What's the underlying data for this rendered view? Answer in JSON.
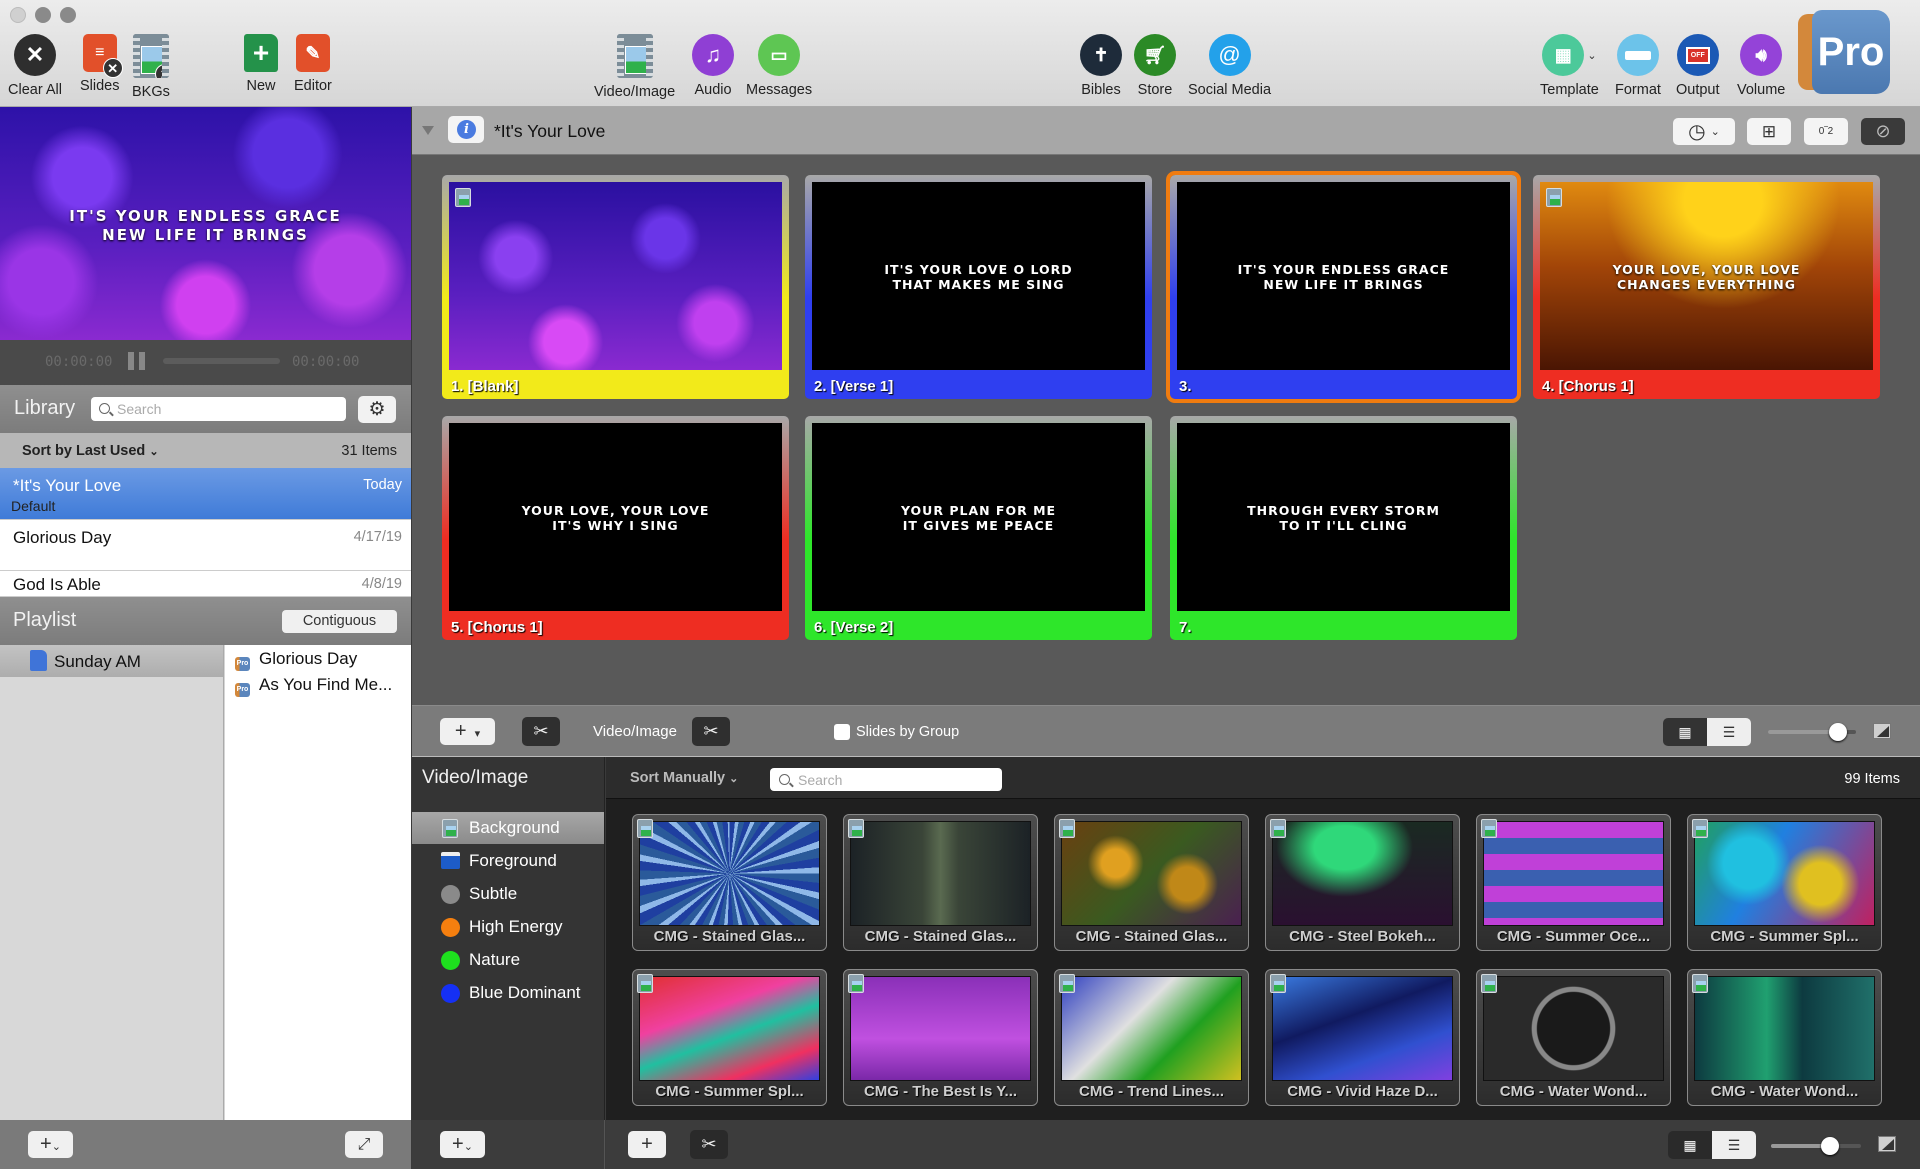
{
  "window": {
    "traffic_lights": [
      "close",
      "minimize",
      "zoom"
    ]
  },
  "toolbar": {
    "left": [
      {
        "label": "Clear All",
        "icon": "clear-all-icon"
      },
      {
        "label": "Slides",
        "icon": "clear-slides-icon"
      },
      {
        "label": "BKGs",
        "icon": "clear-backgrounds-icon"
      },
      {
        "label": "New",
        "icon": "new-document-icon"
      },
      {
        "label": "Editor",
        "icon": "editor-icon"
      }
    ],
    "center": [
      {
        "label": "Video/Image",
        "icon": "video-image-icon"
      },
      {
        "label": "Audio",
        "icon": "audio-icon"
      },
      {
        "label": "Messages",
        "icon": "messages-icon"
      }
    ],
    "center_right": [
      {
        "label": "Bibles",
        "icon": "bible-icon"
      },
      {
        "label": "Store",
        "icon": "store-cart-icon"
      },
      {
        "label": "Social Media",
        "icon": "at-sign-icon"
      }
    ],
    "right": [
      {
        "label": "Template",
        "icon": "template-icon"
      },
      {
        "label": "Format",
        "icon": "format-icon"
      },
      {
        "label": "Output",
        "icon": "output-monitor-icon",
        "badge": "OFF"
      },
      {
        "label": "Volume",
        "icon": "volume-icon"
      }
    ],
    "logo": "Pro"
  },
  "preview": {
    "lyric_line1": "IT'S YOUR ENDLESS GRACE",
    "lyric_line2": "NEW LIFE IT BRINGS",
    "time_elapsed": "00:00:00",
    "time_remaining": "00:00:00"
  },
  "library": {
    "title": "Library",
    "search_placeholder": "Search",
    "sort_label": "Sort by Last Used",
    "count": "31 Items",
    "items": [
      {
        "name": "*It's Your Love",
        "date": "Today",
        "sub": "Default",
        "selected": true
      },
      {
        "name": "Glorious Day",
        "date": "4/17/19"
      },
      {
        "name": "God Is Able",
        "date": "4/8/19"
      }
    ]
  },
  "playlist": {
    "title": "Playlist",
    "mode_button": "Contiguous",
    "playlists": [
      {
        "name": "Sunday AM"
      }
    ],
    "songs": [
      "Glorious Day",
      "As You Find Me..."
    ]
  },
  "document": {
    "title": "*It's Your Love"
  },
  "slides": [
    {
      "label": "1. [Blank]",
      "line1": "",
      "line2": "",
      "color": "#f2ea1a",
      "bg": "purple-bokeh",
      "selected": false
    },
    {
      "label": "2. [Verse 1]",
      "line1": "IT'S YOUR LOVE O LORD",
      "line2": "THAT MAKES ME SING",
      "color": "#2f3ff0",
      "bg": "black",
      "selected": false
    },
    {
      "label": "3.",
      "line1": "IT'S YOUR ENDLESS GRACE",
      "line2": "NEW LIFE IT BRINGS",
      "color": "#2f3ff0",
      "bg": "black",
      "selected": true
    },
    {
      "label": "4. [Chorus 1]",
      "line1": "YOUR LOVE, YOUR LOVE",
      "line2": "CHANGES EVERYTHING",
      "color": "#ee2d22",
      "bg": "amber",
      "selected": false
    },
    {
      "label": "5. [Chorus 1]",
      "line1": "YOUR LOVE, YOUR LOVE",
      "line2": "IT'S WHY I SING",
      "color": "#ee2d22",
      "bg": "black",
      "selected": false
    },
    {
      "label": "6. [Verse 2]",
      "line1": "YOUR PLAN FOR ME",
      "line2": "IT GIVES ME PEACE",
      "color": "#2ee62a",
      "bg": "black",
      "selected": false
    },
    {
      "label": "7.",
      "line1": "THROUGH EVERY STORM",
      "line2": "TO IT I'LL CLING",
      "color": "#2ee62a",
      "bg": "black",
      "selected": false
    }
  ],
  "slide_toolbar": {
    "media_label": "Video/Image",
    "slides_by_group_label": "Slides by Group",
    "slides_by_group_checked": false,
    "view_mode": "grid",
    "zoom_level": 0.8
  },
  "media_bin": {
    "title": "Video/Image",
    "sort_label": "Sort Manually",
    "search_placeholder": "Search",
    "count": "99 Items",
    "categories": [
      {
        "name": "Background",
        "icon": "background-media-icon",
        "selected": true
      },
      {
        "name": "Foreground",
        "icon": "foreground-media-icon"
      },
      {
        "name": "Subtle",
        "color": "#8a8a8a"
      },
      {
        "name": "High Energy",
        "color": "#f57f0f"
      },
      {
        "name": "Nature",
        "color": "#1ee01e"
      },
      {
        "name": "Blue Dominant",
        "color": "#1530f5"
      }
    ],
    "items": [
      {
        "name": "CMG - Stained Glas..."
      },
      {
        "name": "CMG - Stained Glas..."
      },
      {
        "name": "CMG - Stained Glas..."
      },
      {
        "name": "CMG - Steel Bokeh..."
      },
      {
        "name": "CMG - Summer Oce..."
      },
      {
        "name": "CMG - Summer Spl..."
      },
      {
        "name": "CMG - Summer Spl..."
      },
      {
        "name": "CMG - The Best Is Y..."
      },
      {
        "name": "CMG - Trend Lines..."
      },
      {
        "name": "CMG - Vivid Haze D..."
      },
      {
        "name": "CMG - Water Wond..."
      },
      {
        "name": "CMG - Water Wond..."
      }
    ],
    "view_mode": "grid",
    "zoom_level": 0.65
  }
}
